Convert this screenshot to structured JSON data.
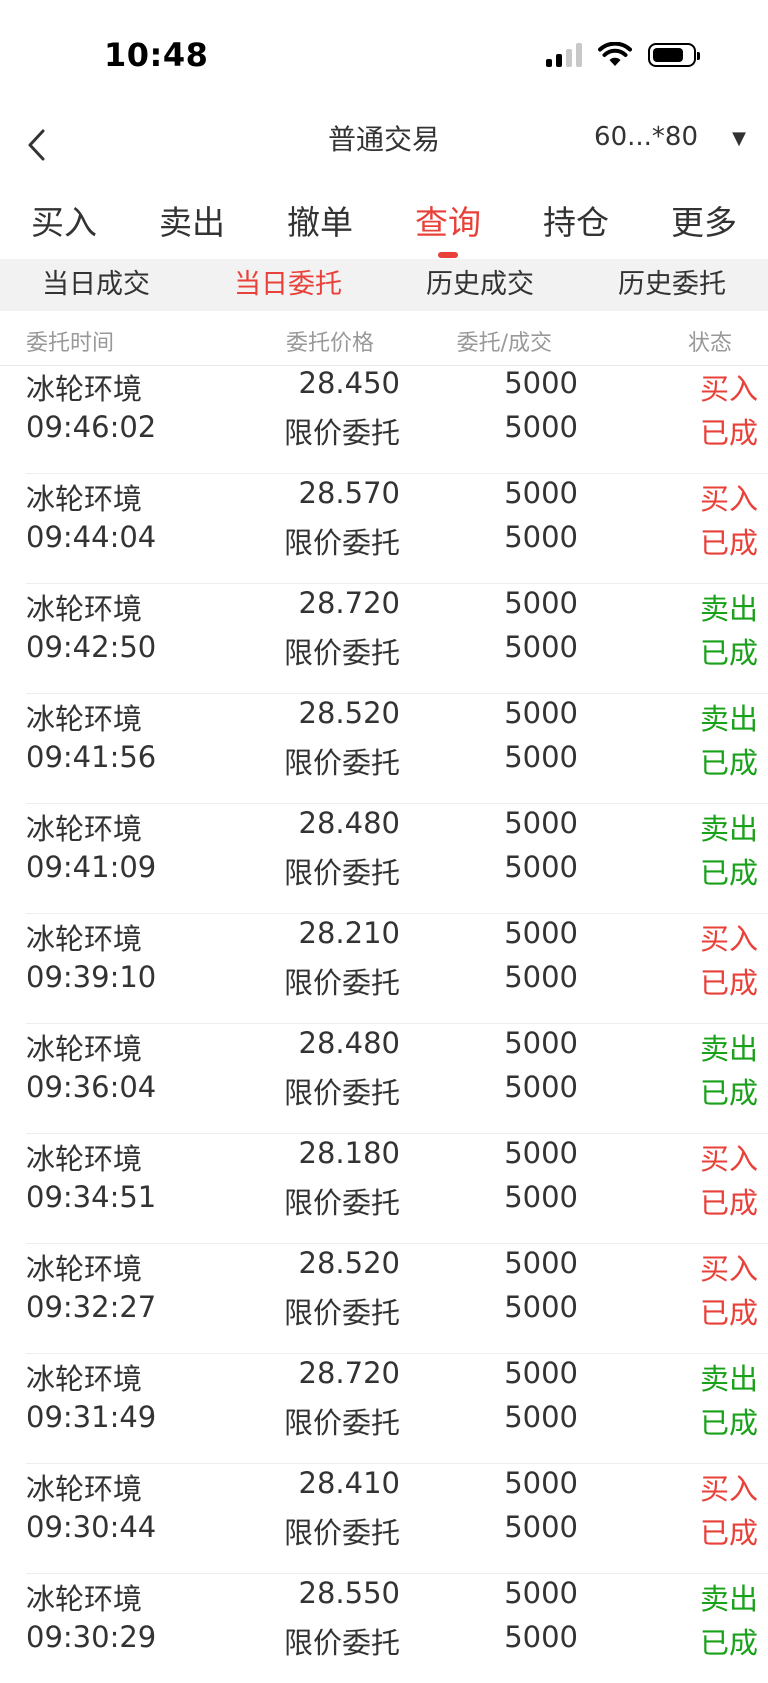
{
  "status_bar": {
    "time": "10:48"
  },
  "nav": {
    "title": "普通交易",
    "account": "60...*80",
    "account_arrow": "▼"
  },
  "main_tabs": [
    {
      "label": "买入",
      "active": false
    },
    {
      "label": "卖出",
      "active": false
    },
    {
      "label": "撤单",
      "active": false
    },
    {
      "label": "查询",
      "active": true
    },
    {
      "label": "持仓",
      "active": false
    },
    {
      "label": "更多",
      "active": false
    }
  ],
  "sub_tabs": [
    {
      "label": "当日成交",
      "active": false
    },
    {
      "label": "当日委托",
      "active": true
    },
    {
      "label": "历史成交",
      "active": false
    },
    {
      "label": "历史委托",
      "active": false
    }
  ],
  "columns": {
    "time": "委托时间",
    "price": "委托价格",
    "qty": "委托/成交",
    "status": "状态"
  },
  "colors": {
    "accent": "#e8413a",
    "buy": "#e8413a",
    "sell": "#1aa11a"
  },
  "orders": [
    {
      "name": "冰轮环境",
      "time": "09:46:02",
      "price": "28.450",
      "price_type": "限价委托",
      "qty": "5000",
      "filled": "5000",
      "direction": "买入",
      "side": "buy",
      "status": "已成"
    },
    {
      "name": "冰轮环境",
      "time": "09:44:04",
      "price": "28.570",
      "price_type": "限价委托",
      "qty": "5000",
      "filled": "5000",
      "direction": "买入",
      "side": "buy",
      "status": "已成"
    },
    {
      "name": "冰轮环境",
      "time": "09:42:50",
      "price": "28.720",
      "price_type": "限价委托",
      "qty": "5000",
      "filled": "5000",
      "direction": "卖出",
      "side": "sell",
      "status": "已成"
    },
    {
      "name": "冰轮环境",
      "time": "09:41:56",
      "price": "28.520",
      "price_type": "限价委托",
      "qty": "5000",
      "filled": "5000",
      "direction": "卖出",
      "side": "sell",
      "status": "已成"
    },
    {
      "name": "冰轮环境",
      "time": "09:41:09",
      "price": "28.480",
      "price_type": "限价委托",
      "qty": "5000",
      "filled": "5000",
      "direction": "卖出",
      "side": "sell",
      "status": "已成"
    },
    {
      "name": "冰轮环境",
      "time": "09:39:10",
      "price": "28.210",
      "price_type": "限价委托",
      "qty": "5000",
      "filled": "5000",
      "direction": "买入",
      "side": "buy",
      "status": "已成"
    },
    {
      "name": "冰轮环境",
      "time": "09:36:04",
      "price": "28.480",
      "price_type": "限价委托",
      "qty": "5000",
      "filled": "5000",
      "direction": "卖出",
      "side": "sell",
      "status": "已成"
    },
    {
      "name": "冰轮环境",
      "time": "09:34:51",
      "price": "28.180",
      "price_type": "限价委托",
      "qty": "5000",
      "filled": "5000",
      "direction": "买入",
      "side": "buy",
      "status": "已成"
    },
    {
      "name": "冰轮环境",
      "time": "09:32:27",
      "price": "28.520",
      "price_type": "限价委托",
      "qty": "5000",
      "filled": "5000",
      "direction": "买入",
      "side": "buy",
      "status": "已成"
    },
    {
      "name": "冰轮环境",
      "time": "09:31:49",
      "price": "28.720",
      "price_type": "限价委托",
      "qty": "5000",
      "filled": "5000",
      "direction": "卖出",
      "side": "sell",
      "status": "已成"
    },
    {
      "name": "冰轮环境",
      "time": "09:30:44",
      "price": "28.410",
      "price_type": "限价委托",
      "qty": "5000",
      "filled": "5000",
      "direction": "买入",
      "side": "buy",
      "status": "已成"
    },
    {
      "name": "冰轮环境",
      "time": "09:30:29",
      "price": "28.550",
      "price_type": "限价委托",
      "qty": "5000",
      "filled": "5000",
      "direction": "卖出",
      "side": "sell",
      "status": "已成"
    }
  ]
}
